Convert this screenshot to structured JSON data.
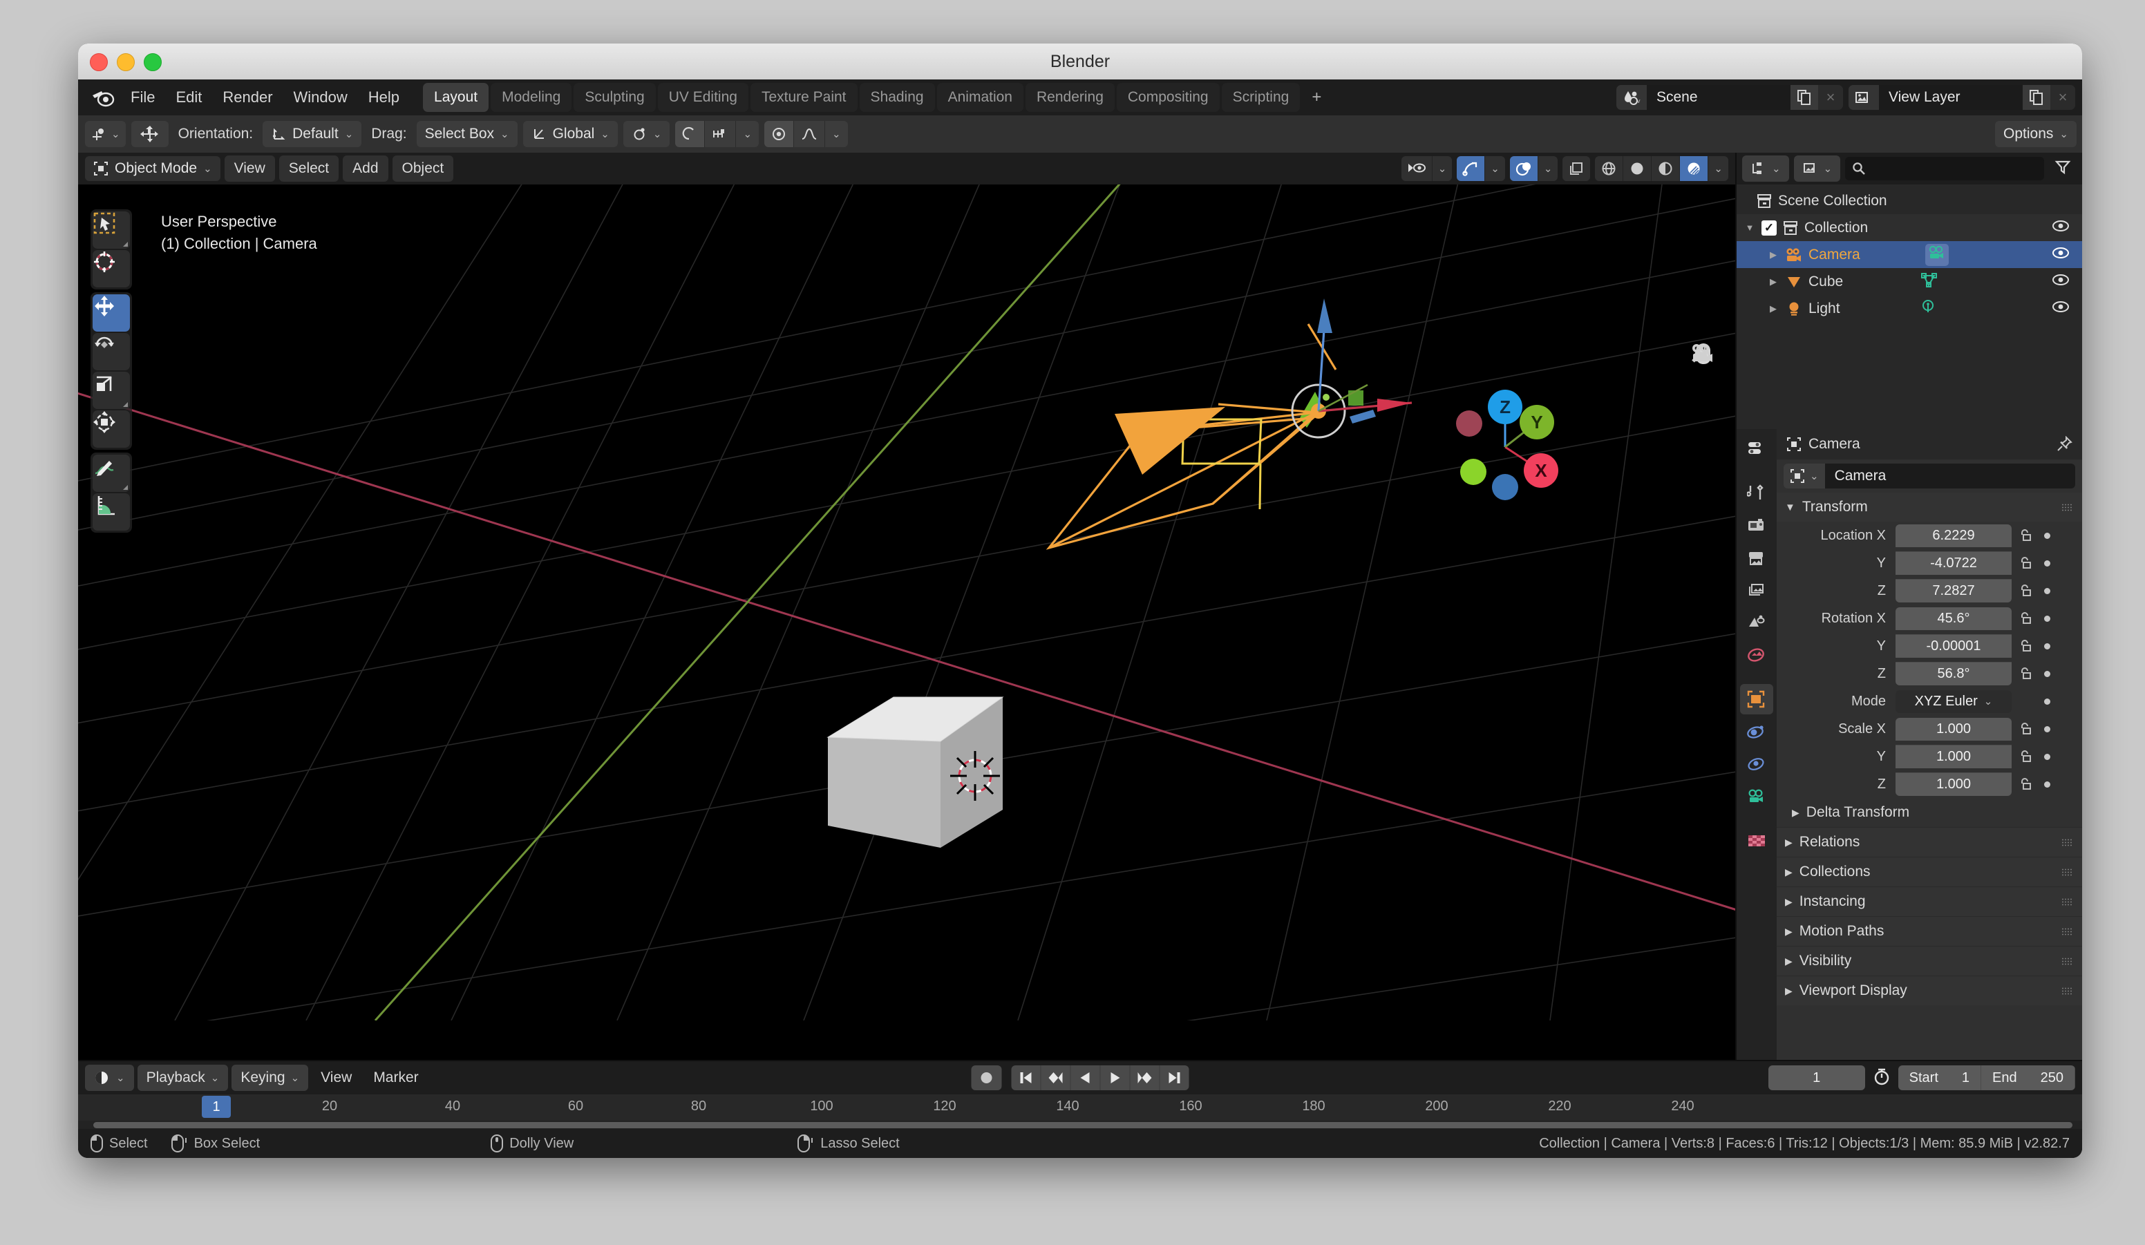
{
  "window": {
    "title": "Blender"
  },
  "topbar": {
    "menus": [
      "File",
      "Edit",
      "Render",
      "Window",
      "Help"
    ],
    "workspaces": [
      {
        "label": "Layout",
        "active": true
      },
      {
        "label": "Modeling",
        "active": false
      },
      {
        "label": "Sculpting",
        "active": false
      },
      {
        "label": "UV Editing",
        "active": false
      },
      {
        "label": "Texture Paint",
        "active": false
      },
      {
        "label": "Shading",
        "active": false
      },
      {
        "label": "Animation",
        "active": false
      },
      {
        "label": "Rendering",
        "active": false
      },
      {
        "label": "Compositing",
        "active": false
      },
      {
        "label": "Scripting",
        "active": false
      }
    ],
    "add_workspace": "+",
    "scene": {
      "name": "Scene",
      "new_label": "",
      "close_label": "×"
    },
    "view_layer": {
      "name": "View Layer",
      "new_label": "",
      "close_label": "×"
    }
  },
  "toolrow": {
    "orientation_label": "Orientation:",
    "orientation_value": "Default",
    "drag_label": "Drag:",
    "drag_value": "Select Box",
    "transform_space": "Global",
    "options_label": "Options"
  },
  "viewport_header": {
    "mode": "Object Mode",
    "menus": [
      "View",
      "Select",
      "Add",
      "Object"
    ]
  },
  "viewport": {
    "perspective": "User Perspective",
    "active_object": "(1) Collection | Camera",
    "gizmo_axes": [
      "Z",
      "Y",
      "X"
    ],
    "tools": [
      "tweak-select-tool",
      "cursor-tool",
      "move-tool",
      "rotate-tool",
      "scale-tool",
      "transform-tool",
      "annotate-tool",
      "measure-tool"
    ],
    "nav_icons": [
      "zoom-icon",
      "hand-icon",
      "camera-icon",
      "grid-icon"
    ]
  },
  "outliner": {
    "search_placeholder": "",
    "rows": [
      {
        "label": "Scene Collection",
        "icon": "collection-icon",
        "indent": 0,
        "selected": false,
        "checkbox": false,
        "disclosure": "",
        "eye": false
      },
      {
        "label": "Collection",
        "icon": "collection-icon",
        "indent": 1,
        "selected": false,
        "checkbox": true,
        "disclosure": "▼",
        "eye": true
      },
      {
        "label": "Camera",
        "icon": "camera-obj-icon",
        "indent": 2,
        "selected": true,
        "checkbox": false,
        "disclosure": "▶",
        "eye": true,
        "data_icon": "camera-data-icon"
      },
      {
        "label": "Cube",
        "icon": "mesh-obj-icon",
        "indent": 2,
        "selected": false,
        "checkbox": false,
        "disclosure": "▶",
        "eye": true,
        "data_icon": "mesh-data-icon"
      },
      {
        "label": "Light",
        "icon": "light-obj-icon",
        "indent": 2,
        "selected": false,
        "checkbox": false,
        "disclosure": "▶",
        "eye": true,
        "data_icon": "light-data-icon"
      }
    ]
  },
  "properties": {
    "breadcrumb": "Camera",
    "object_name": "Camera",
    "tabs": [
      "tool-tab",
      "render-tab",
      "output-tab",
      "view-layer-tab",
      "scene-tab",
      "world-tab",
      "object-tab",
      "modifiers-tab",
      "physics-tab",
      "object-data-tab",
      "texture-tab"
    ],
    "active_tab_index": 6,
    "transform_panel": "Transform",
    "fields": [
      {
        "label": "Location X",
        "value": "6.2229"
      },
      {
        "label": "Y",
        "value": "-4.0722"
      },
      {
        "label": "Z",
        "value": "7.2827"
      },
      {
        "label": "Rotation X",
        "value": "45.6°"
      },
      {
        "label": "Y",
        "value": "-0.00001"
      },
      {
        "label": "Z",
        "value": "56.8°"
      },
      {
        "label": "Mode",
        "value": "XYZ Euler"
      },
      {
        "label": "Scale X",
        "value": "1.000"
      },
      {
        "label": "Y",
        "value": "1.000"
      },
      {
        "label": "Z",
        "value": "1.000"
      }
    ],
    "delta_transform": "Delta Transform",
    "panels": [
      "Relations",
      "Collections",
      "Instancing",
      "Motion Paths",
      "Visibility",
      "Viewport Display"
    ]
  },
  "timeline": {
    "menus": [
      "View",
      "Marker"
    ],
    "dropdowns": [
      "Playback",
      "Keying"
    ],
    "current_frame": "1",
    "start_label": "Start",
    "start_value": "1",
    "end_label": "End",
    "end_value": "250",
    "ticks": [
      "20",
      "40",
      "60",
      "80",
      "100",
      "120",
      "140",
      "160",
      "180",
      "200",
      "220",
      "240"
    ],
    "playhead": "1"
  },
  "status": {
    "hints": [
      {
        "icon": "mouse-left-icon",
        "label": "Select"
      },
      {
        "icon": "mouse-drag-icon",
        "label": "Box Select"
      },
      {
        "icon": "mouse-middle-icon",
        "label": "Dolly View"
      },
      {
        "icon": "mouse-right-icon",
        "label": "Lasso Select"
      }
    ],
    "stats": "Collection | Camera | Verts:8 | Faces:6 | Tris:12 | Objects:1/3 | Mem: 85.9 MiB | v2.82.7"
  },
  "colors": {
    "accent_blue": "#4772b3",
    "selected_orange": "#e8a33d",
    "axis_x": "#c1344a",
    "axis_y": "#7aa832",
    "panel_bg": "#303030"
  }
}
